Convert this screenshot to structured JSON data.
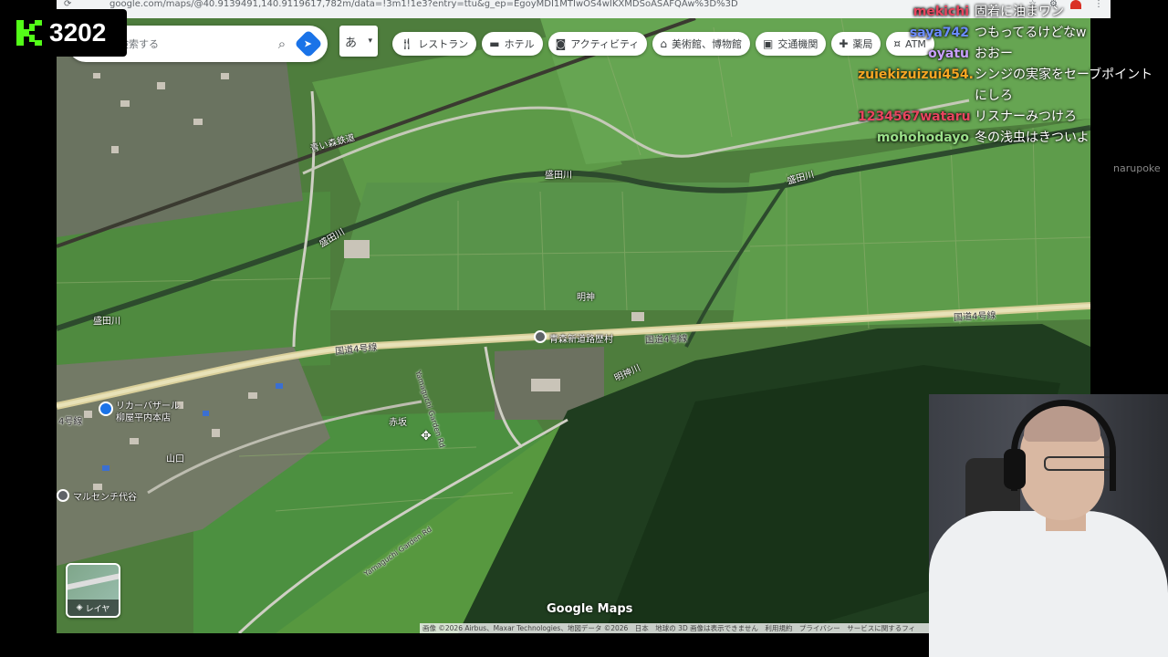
{
  "browser": {
    "url": "google.com/maps/@40.9139491,140.9119617,782m/data=!3m1!1e3?entry=ttu&g_ep=EgoyMDI1MTIwOS4wIKXMDSoASAFQAw%3D%3D",
    "nav_icon": "reload-icon"
  },
  "map": {
    "search_placeholder": "マップを検索する",
    "search_icon": "search-icon",
    "directions_icon": "directions-icon",
    "ime_label": "あ",
    "chips": [
      {
        "icon": "restaurant-icon",
        "label": "レストラン"
      },
      {
        "icon": "hotel-icon",
        "label": "ホテル"
      },
      {
        "icon": "camera-icon",
        "label": "アクティビティ"
      },
      {
        "icon": "museum-icon",
        "label": "美術館、博物館"
      },
      {
        "icon": "transit-icon",
        "label": "交通機関"
      },
      {
        "icon": "pharmacy-icon",
        "label": "薬局"
      },
      {
        "icon": "atm-icon",
        "label": "ATM"
      }
    ],
    "labels": {
      "aomori_railway": "青い森鉄道",
      "morita_river_1": "盛田川",
      "morita_river_2": "盛田川",
      "morita_river_3": "盛田川",
      "morita_river_4": "盛田川",
      "myojin": "明神",
      "myojin_river": "明神川",
      "route4_a": "国道4号線",
      "route4_b": "国道4号線",
      "route4_c": "国道4号線",
      "route4_d": "4号線",
      "aomori_shindo": "青森新道路歴村",
      "yamaguchi_garden_1": "Yamaguchi Garden Rd",
      "yamaguchi_garden_2": "Yamaguchi Garden Rd",
      "akasaka": "赤坂",
      "yamaguchi": "山口",
      "liquor_line1": "リカーバザール",
      "liquor_line2": "柳屋平内本店",
      "marusen": "マルセンチ代谷"
    },
    "layers_label": "レイヤ",
    "logo": "Google Maps",
    "attribution": "画像 ©2026 Airbus、Maxar Technologies、地図データ ©2026　日本　地球の 3D 画像は表示できません　利用規約　プライバシー　サービスに関するフィ"
  },
  "stream": {
    "viewer_count": "3202",
    "chat": [
      {
        "user": "mekichi",
        "color": "#e8455f",
        "message": "固着に油まワン"
      },
      {
        "user": "saya742",
        "color": "#6b8cff",
        "message": "つもってるけどなw"
      },
      {
        "user": "oyatu",
        "color": "#c9a0ff",
        "message": "おおー"
      },
      {
        "user": "zuiekizuizui454...",
        "color": "#f6a623",
        "message": "シンジの実家をセーブポイントにしろ"
      },
      {
        "user": "1234567wataru",
        "color": "#e8455f",
        "message": "リスナーみつけろ"
      },
      {
        "user": "mohohodayo",
        "color": "#9be08a",
        "message": "冬の浅虫はきついよ"
      }
    ],
    "side_user": "narupoke"
  }
}
